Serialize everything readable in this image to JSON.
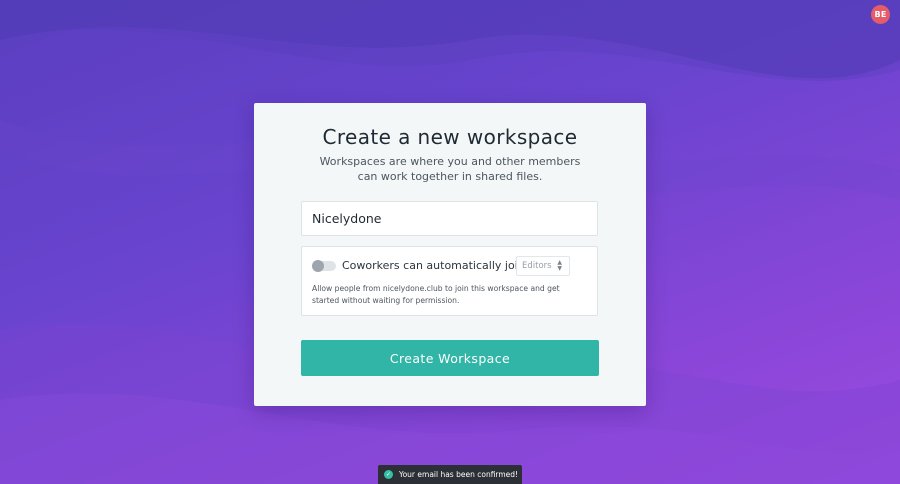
{
  "user": {
    "avatar_initials": "BE",
    "avatar_color": "#e45c6a"
  },
  "workspace_form": {
    "title": "Create a new workspace",
    "subtitle_line1": "Workspaces are where you and other members",
    "subtitle_line2": "can work together in shared files.",
    "name_value": "Nicelydone",
    "auto_join": {
      "enabled": false,
      "label": "Coworkers can automatically join as",
      "role_selected": "Editors",
      "help_text": "Allow people from nicelydone.club to join this workspace and get started without waiting for permission."
    },
    "submit_label": "Create Workspace",
    "accent_color": "#30b5a6"
  },
  "toast": {
    "message": "Your email has been confirmed!",
    "icon": "check-circle-icon"
  }
}
